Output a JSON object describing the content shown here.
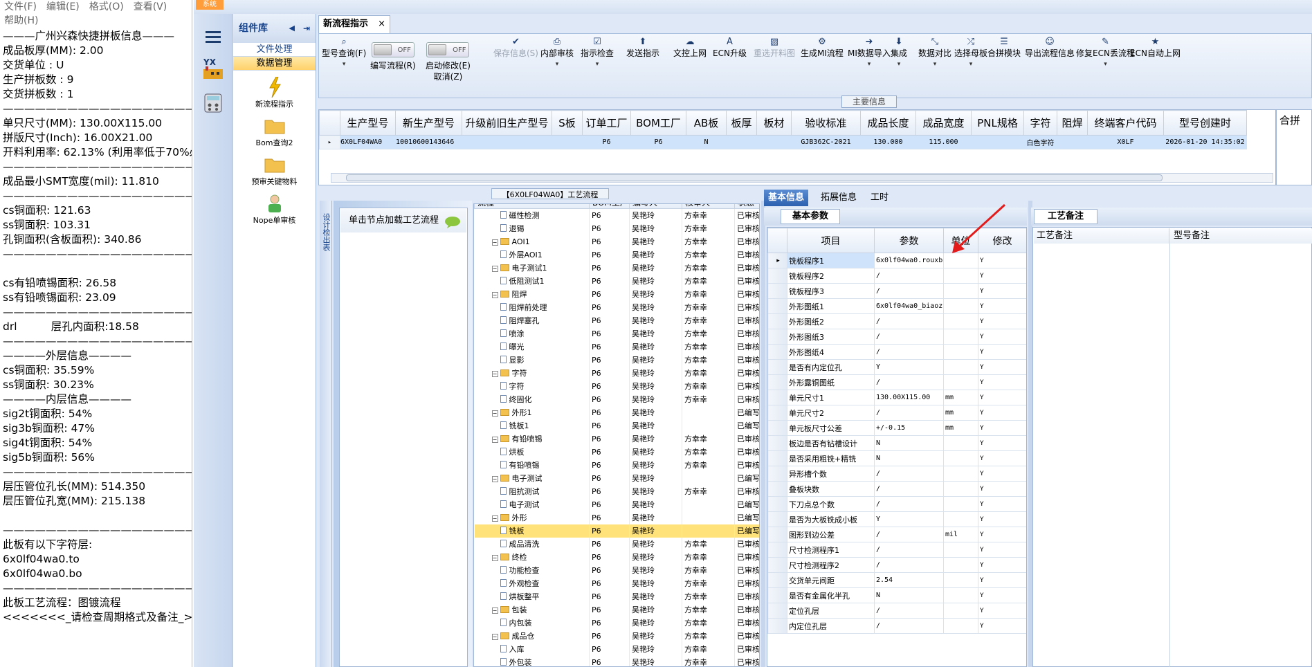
{
  "notepad": {
    "menu": [
      "文件(F)",
      "编辑(E)",
      "格式(O)",
      "查看(V)",
      "帮助(H)"
    ],
    "lines": [
      "———广州兴森快捷拼板信息———",
      "成品板厚(MM): 2.00",
      "交货单位 : U",
      "生产拼板数 : 9",
      "交货拼板数 : 1",
      "——————————————————",
      "单只尺寸(MM): 130.00X115.00",
      "拼版尺寸(Inch): 16.00X21.00",
      "开料利用率: 62.13% (利用率低于70%必",
      "——————————————————",
      "成品最小SMT宽度(mil): 11.810",
      "——————————————————",
      "cs铜面积: 121.63",
      "ss铜面积: 103.31",
      "孔铜面积(含板面积): 340.86",
      "——————————————————",
      "",
      "cs有铅喷锡面积: 26.58",
      "ss有铅喷锡面积: 23.09",
      "——————————————————",
      "drl          层孔内面积:18.58",
      "——————————————————",
      "————外层信息————",
      "cs铜面积: 35.59%",
      "ss铜面积: 30.23%",
      "————内层信息————",
      "sig2t铜面积: 54%",
      "sig3b铜面积: 47%",
      "sig4t铜面积: 54%",
      "sig5b铜面积: 56%",
      "——————————————————",
      "层压管位孔长(MM): 514.350",
      "层压管位孔宽(MM): 215.138",
      "",
      "——————————————————",
      "此板有以下字符层:",
      "6x0lf04wa0.to",
      "6x0lf04wa0.bo",
      "——————————————————",
      "此板工艺流程：图镀流程",
      "<<<<<<<_请检查周期格式及备注_>>"
    ]
  },
  "app": {
    "system_tab": "系统",
    "complib_title": "组件库",
    "complib_tabs": [
      "文件处理",
      "数据管理"
    ],
    "complib_items": [
      "新流程指示",
      "Bom查询2",
      "预审关键物料",
      "Nope单审核"
    ],
    "doc_tab": "新流程指示",
    "ribbon": [
      {
        "label": "型号查询(F)",
        "icon": "search-icon"
      },
      {
        "label": "编写流程(R)",
        "icon": "toggle",
        "state": "OFF"
      },
      {
        "label": "启动修改(E)",
        "sub": "取消(Z)",
        "icon": "toggle",
        "state": "OFF"
      },
      {
        "label": "保存信息(S)",
        "icon": "check-icon",
        "disabled": true
      },
      {
        "label": "内部审核",
        "icon": "printer-icon"
      },
      {
        "label": "指示检查",
        "icon": "checkbox-icon"
      },
      {
        "label": "发送指示",
        "icon": "upload-icon"
      },
      {
        "label": "文控上网",
        "icon": "cloud-upload-icon"
      },
      {
        "label": "ECN升级",
        "icon": "a-icon"
      },
      {
        "label": "重选开料图",
        "icon": "image-icon",
        "disabled": true
      },
      {
        "label": "生成MI流程",
        "icon": "gears-icon"
      },
      {
        "label": "MI数据导入",
        "icon": "sign-in-icon"
      },
      {
        "label": "集成",
        "icon": "download-icon"
      },
      {
        "label": "数据对比",
        "icon": "compress-icon"
      },
      {
        "label": "选择母板",
        "icon": "shuffle-icon"
      },
      {
        "label": "合拼模块",
        "icon": "list-icon"
      },
      {
        "label": "导出流程信息",
        "icon": "smile-icon"
      },
      {
        "label": "修复ECN丢流程",
        "icon": "wrench-icon"
      },
      {
        "label": "ECN自动上网",
        "icon": "star-icon"
      }
    ],
    "main_info_label": "主要信息",
    "main_grid": {
      "columns": [
        "生产型号",
        "新生产型号",
        "升级前旧生产型号",
        "S板",
        "订单工厂",
        "BOM工厂",
        "AB板",
        "板厚",
        "板材",
        "验收标准",
        "成品长度",
        "成品宽度",
        "PNL规格",
        "字符",
        "阻焊",
        "终端客户代码",
        "型号创建时"
      ],
      "row": [
        "6X0LF04WA0",
        "10010600143646",
        "",
        "",
        "P6",
        "P6",
        "N",
        "",
        "",
        "GJB362C-2021",
        "130.000",
        "115.000",
        "",
        "白色字符",
        "",
        "X0LF",
        "2026-01-20 14:35:02"
      ]
    },
    "right_panel_label": "合拼",
    "process_title": "【6X0LF04WA0】工艺流程",
    "process_side": "设计检出表",
    "process_hint": "单击节点加载工艺流程",
    "tree_columns": [
      "流程",
      "BOM工厂",
      "编写人",
      "核审人",
      "状态"
    ],
    "tree_rows": [
      [
        "2",
        "doc",
        "磁性检测",
        "P6",
        "吴艳玲",
        "方幸幸",
        "已审核"
      ],
      [
        "2",
        "doc",
        "退锡",
        "P6",
        "吴艳玲",
        "方幸幸",
        "已审核"
      ],
      [
        "1",
        "fold",
        "AOI1",
        "P6",
        "吴艳玲",
        "方幸幸",
        "已审核"
      ],
      [
        "2",
        "doc",
        "外层AOI1",
        "P6",
        "吴艳玲",
        "方幸幸",
        "已审核"
      ],
      [
        "1",
        "fold",
        "电子测试1",
        "P6",
        "吴艳玲",
        "方幸幸",
        "已审核"
      ],
      [
        "2",
        "doc",
        "低阻测试1",
        "P6",
        "吴艳玲",
        "方幸幸",
        "已审核"
      ],
      [
        "1",
        "fold",
        "阻焊",
        "P6",
        "吴艳玲",
        "方幸幸",
        "已审核"
      ],
      [
        "2",
        "doc",
        "阻焊前处理",
        "P6",
        "吴艳玲",
        "方幸幸",
        "已审核"
      ],
      [
        "2",
        "doc",
        "阻焊塞孔",
        "P6",
        "吴艳玲",
        "方幸幸",
        "已审核"
      ],
      [
        "2",
        "doc",
        "喷涂",
        "P6",
        "吴艳玲",
        "方幸幸",
        "已审核"
      ],
      [
        "2",
        "doc",
        "曝光",
        "P6",
        "吴艳玲",
        "方幸幸",
        "已审核"
      ],
      [
        "2",
        "doc",
        "显影",
        "P6",
        "吴艳玲",
        "方幸幸",
        "已审核"
      ],
      [
        "1",
        "fold",
        "字符",
        "P6",
        "吴艳玲",
        "方幸幸",
        "已审核"
      ],
      [
        "2",
        "doc",
        "字符",
        "P6",
        "吴艳玲",
        "方幸幸",
        "已审核"
      ],
      [
        "2",
        "doc",
        "终固化",
        "P6",
        "吴艳玲",
        "方幸幸",
        "已审核"
      ],
      [
        "1",
        "fold",
        "外形1",
        "P6",
        "吴艳玲",
        "",
        "已编写"
      ],
      [
        "2",
        "doc",
        "铣板1",
        "P6",
        "吴艳玲",
        "",
        "已编写"
      ],
      [
        "1",
        "fold",
        "有铅喷锡",
        "P6",
        "吴艳玲",
        "方幸幸",
        "已审核"
      ],
      [
        "2",
        "doc",
        "烘板",
        "P6",
        "吴艳玲",
        "方幸幸",
        "已审核"
      ],
      [
        "2",
        "doc",
        "有铅喷锡",
        "P6",
        "吴艳玲",
        "方幸幸",
        "已审核"
      ],
      [
        "1",
        "fold",
        "电子测试",
        "P6",
        "吴艳玲",
        "",
        "已编写"
      ],
      [
        "2",
        "doc",
        "阻抗测试",
        "P6",
        "吴艳玲",
        "方幸幸",
        "已审核"
      ],
      [
        "2",
        "doc",
        "电子测试",
        "P6",
        "吴艳玲",
        "",
        "已编写"
      ],
      [
        "1",
        "fold",
        "外形",
        "P6",
        "吴艳玲",
        "",
        "已编写"
      ],
      [
        "2",
        "doc",
        "铣板",
        "P6",
        "吴艳玲",
        "",
        "已编写"
      ],
      [
        "2",
        "doc",
        "成品清洗",
        "P6",
        "吴艳玲",
        "方幸幸",
        "已审核"
      ],
      [
        "1",
        "fold",
        "终检",
        "P6",
        "吴艳玲",
        "方幸幸",
        "已审核"
      ],
      [
        "2",
        "doc",
        "功能检查",
        "P6",
        "吴艳玲",
        "方幸幸",
        "已审核"
      ],
      [
        "2",
        "doc",
        "外观检查",
        "P6",
        "吴艳玲",
        "方幸幸",
        "已审核"
      ],
      [
        "2",
        "doc",
        "烘板整平",
        "P6",
        "吴艳玲",
        "方幸幸",
        "已审核"
      ],
      [
        "1",
        "fold",
        "包装",
        "P6",
        "吴艳玲",
        "方幸幸",
        "已审核"
      ],
      [
        "2",
        "doc",
        "内包装",
        "P6",
        "吴艳玲",
        "方幸幸",
        "已审核"
      ],
      [
        "1",
        "fold",
        "成品仓",
        "P6",
        "吴艳玲",
        "方幸幸",
        "已审核"
      ],
      [
        "2",
        "doc",
        "入库",
        "P6",
        "吴艳玲",
        "方幸幸",
        "已审核"
      ],
      [
        "2",
        "doc",
        "外包装",
        "P6",
        "吴艳玲",
        "方幸幸",
        "已审核"
      ]
    ],
    "selected_tree_row": 24,
    "bi_tabs": [
      "基本信息",
      "拓展信息",
      "工时"
    ],
    "bi_subtab": "基本参数",
    "bi_columns": [
      "项目",
      "参数",
      "单位",
      "修改"
    ],
    "bi_rows": [
      [
        "铣板程序1",
        "6x0lf04wa0.rouxb",
        "",
        "Y"
      ],
      [
        "铣板程序2",
        "/",
        "",
        "Y"
      ],
      [
        "铣板程序3",
        "/",
        "",
        "Y"
      ],
      [
        "外形图纸1",
        "6x0lf04wa0_biaoz...",
        "",
        "Y"
      ],
      [
        "外形图纸2",
        "/",
        "",
        "Y"
      ],
      [
        "外形图纸3",
        "/",
        "",
        "Y"
      ],
      [
        "外形图纸4",
        "/",
        "",
        "Y"
      ],
      [
        "是否有内定位孔",
        "Y",
        "",
        "Y"
      ],
      [
        "外形露铜图纸",
        "/",
        "",
        "Y"
      ],
      [
        "单元尺寸1",
        "130.00X115.00",
        "mm",
        "Y"
      ],
      [
        "单元尺寸2",
        "/",
        "mm",
        "Y"
      ],
      [
        "单元板尺寸公差",
        "+/-0.15",
        "mm",
        "Y"
      ],
      [
        "板边是否有钻槽设计",
        "N",
        "",
        "Y"
      ],
      [
        "是否采用粗铣+精铣",
        "N",
        "",
        "Y"
      ],
      [
        "异形槽个数",
        "/",
        "",
        "Y"
      ],
      [
        "叠板块数",
        "/",
        "",
        "Y"
      ],
      [
        "下刀点总个数",
        "/",
        "",
        "Y"
      ],
      [
        "是否为大板铣成小板",
        "Y",
        "",
        "Y"
      ],
      [
        "图形到边公差",
        "/",
        "mil",
        "Y"
      ],
      [
        "尺寸检测程序1",
        "/",
        "",
        "Y"
      ],
      [
        "尺寸检测程序2",
        "/",
        "",
        "Y"
      ],
      [
        "交货单元间距",
        "2.54",
        "",
        "Y"
      ],
      [
        "是否有金属化半孔",
        "N",
        "",
        "Y"
      ],
      [
        "定位孔层",
        "/",
        "",
        "Y"
      ],
      [
        "内定位孔层",
        "/",
        "",
        "Y"
      ]
    ],
    "pn_subtab": "工艺备注",
    "pn_cols": [
      "工艺备注",
      "型号备注"
    ]
  },
  "colors": {
    "accent": "#2c61b0",
    "selected_row": "#ffe27a",
    "arrow": "#e31b1b"
  }
}
